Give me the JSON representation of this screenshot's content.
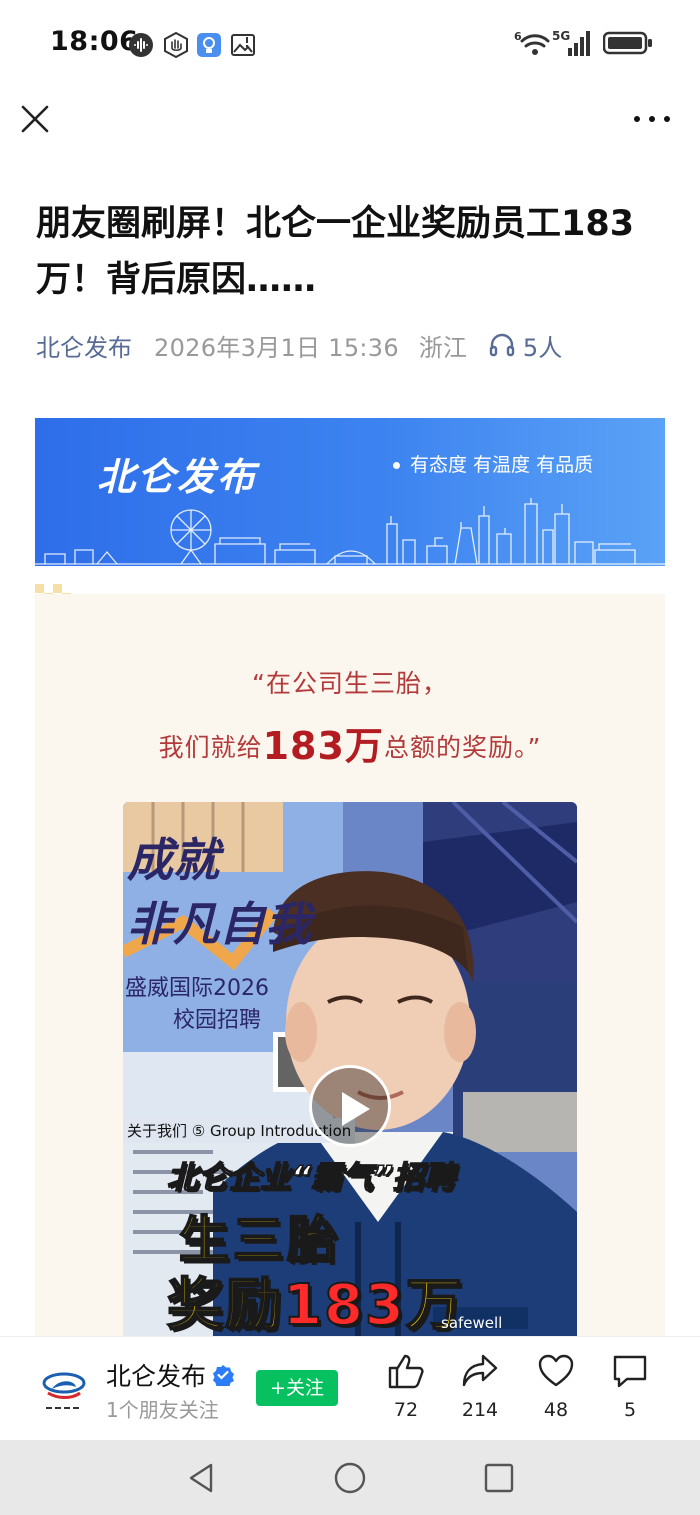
{
  "status_bar": {
    "time": "18:06",
    "wifi_label": "6",
    "network": "5G"
  },
  "nav": {
    "close_icon": "close-icon",
    "more_icon": "more-icon"
  },
  "article": {
    "title": "朋友圈刷屏！北仑一企业奖励员工183万！背后原因……",
    "account": "北仑发布",
    "date": "2026年3月1日 15:36",
    "region": "浙江",
    "listeners": "5人"
  },
  "banner": {
    "title": "北仑发布",
    "slogan": "有态度  有温度  有品质"
  },
  "content": {
    "quote_line1": "“在公司生三胎，",
    "quote_line2_pre": "我们就给",
    "quote_line2_big": "183万",
    "quote_line2_post": "总额的奖励。”"
  },
  "video": {
    "poster_title1": "成就",
    "poster_title2": "非凡自我",
    "poster_sub1": "盛威国际2026",
    "poster_sub2": "校园招聘",
    "poster_about": "关于我们 ⑤ Group Introduction",
    "caption1": "北仑企业“霸气”招聘",
    "caption2": "生三胎",
    "caption3_pre": "奖励",
    "caption3_num": "183",
    "caption3_post": "万",
    "brand": "safewell"
  },
  "bottom_bar": {
    "account_name": "北仑发布",
    "fans": "1个朋友关注",
    "follow_label": "+关注",
    "likes": "72",
    "shares": "214",
    "favorites": "48",
    "comments": "5"
  },
  "colors": {
    "link_blue": "#576b95",
    "banner_blue": "#2e6ee9",
    "quote_red": "#b33a3a",
    "follow_green": "#07c160",
    "card_bg": "#fcf7ee"
  }
}
